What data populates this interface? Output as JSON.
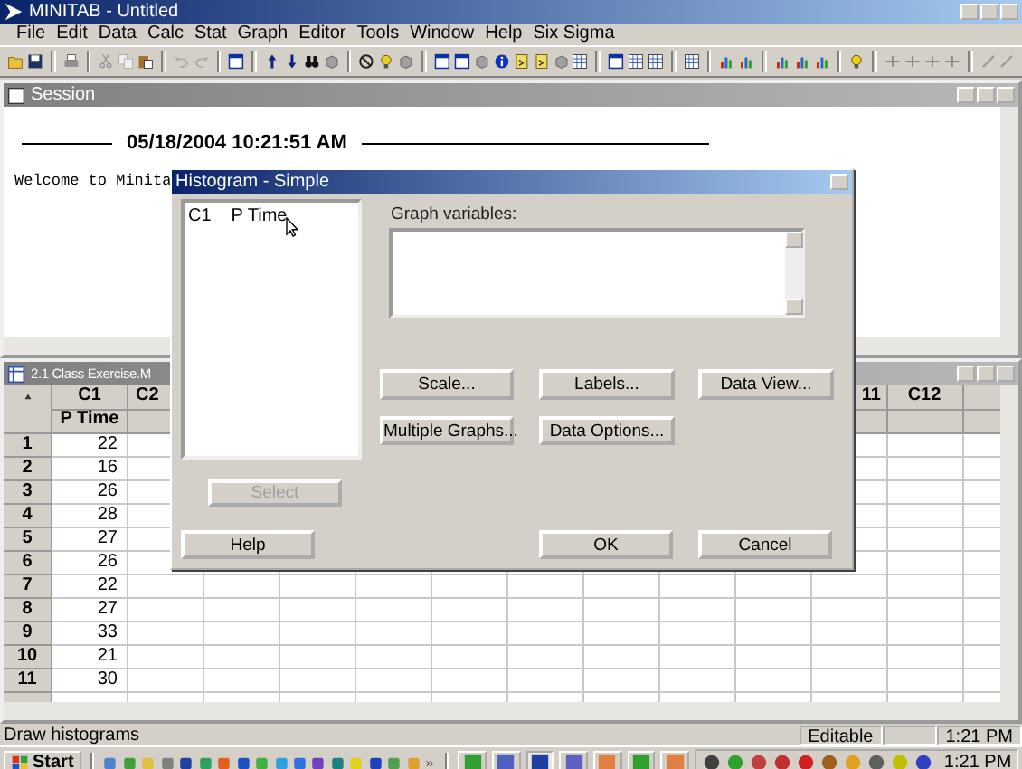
{
  "window": {
    "title": "MINITAB - Untitled"
  },
  "menu": [
    "File",
    "Edit",
    "Data",
    "Calc",
    "Stat",
    "Graph",
    "Editor",
    "Tools",
    "Window",
    "Help",
    "Six Sigma"
  ],
  "session": {
    "title": "Session",
    "timestamp": "05/18/2004 10:21:51 AM",
    "text": "Welcome to Minita"
  },
  "worksheet": {
    "title": "2.1 Class Exercise.M",
    "columns": [
      {
        "header": "C1",
        "name": "P Time",
        "values": [
          "22",
          "16",
          "26",
          "28",
          "27",
          "26",
          "22",
          "27",
          "33",
          "21",
          "30"
        ]
      },
      {
        "header": "C2"
      },
      {
        "header": "11"
      },
      {
        "header": "C12"
      }
    ],
    "row_numbers": [
      "1",
      "2",
      "3",
      "4",
      "5",
      "6",
      "7",
      "8",
      "9",
      "10",
      "11"
    ]
  },
  "dialog": {
    "title": "Histogram - Simple",
    "variables": [
      {
        "column": "C1",
        "name": "P Time"
      }
    ],
    "graph_variables_label": "Graph variables:",
    "option_buttons": [
      "Scale...",
      "Labels...",
      "Data View...",
      "Multiple Graphs...",
      "Data Options..."
    ],
    "select_button": {
      "label": "Select",
      "disabled": true
    },
    "buttons": [
      "Help",
      "OK",
      "Cancel"
    ]
  },
  "status_bar": {
    "message": "Draw histograms",
    "mode": "Editable",
    "time": "1:21 PM"
  },
  "taskbar": {
    "start": "Start",
    "clock": "1:21 PM"
  }
}
